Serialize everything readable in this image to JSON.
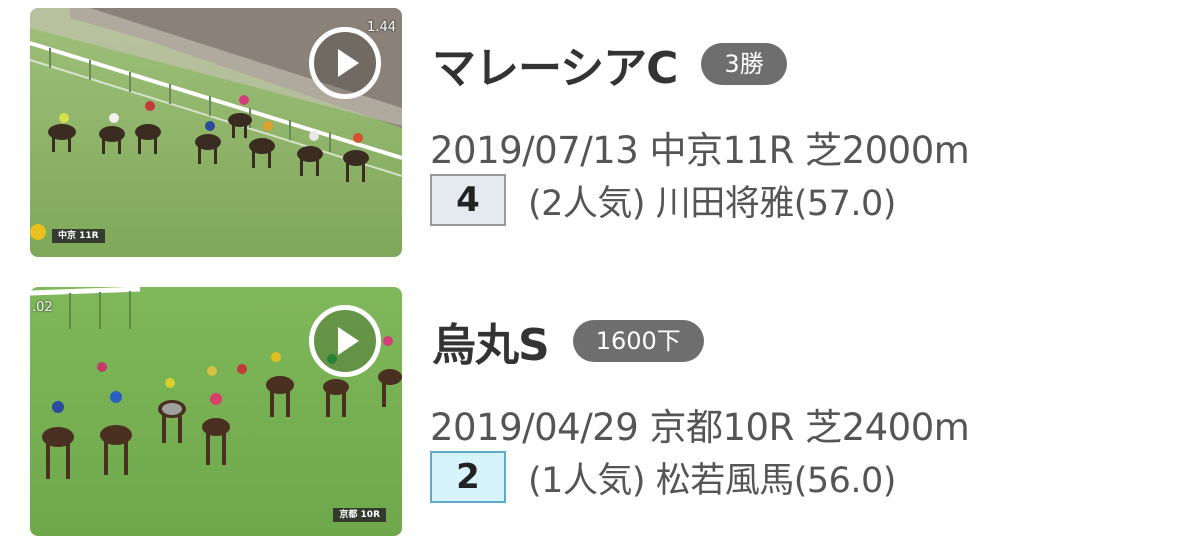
{
  "races": [
    {
      "video": {
        "timecode": "1.44",
        "course_tag": "中京 11R",
        "play_icon": "play-icon"
      },
      "name": "マレーシアC",
      "class": "3勝",
      "meta": "2019/07/13 中京11R 芝2000m",
      "rank": "4",
      "jockey_info": "(2人気) 川田将雅(57.0)",
      "rank_color": "#e5eaf0"
    },
    {
      "video": {
        "timecode": ".02",
        "course_tag": "京都 10R",
        "play_icon": "play-icon"
      },
      "name": "烏丸S",
      "class": "1600下",
      "meta": "2019/04/29 京都10R 芝2400m",
      "rank": "2",
      "jockey_info": "(1人気) 松若風馬(56.0)",
      "rank_color": "#d7f3fb"
    }
  ]
}
